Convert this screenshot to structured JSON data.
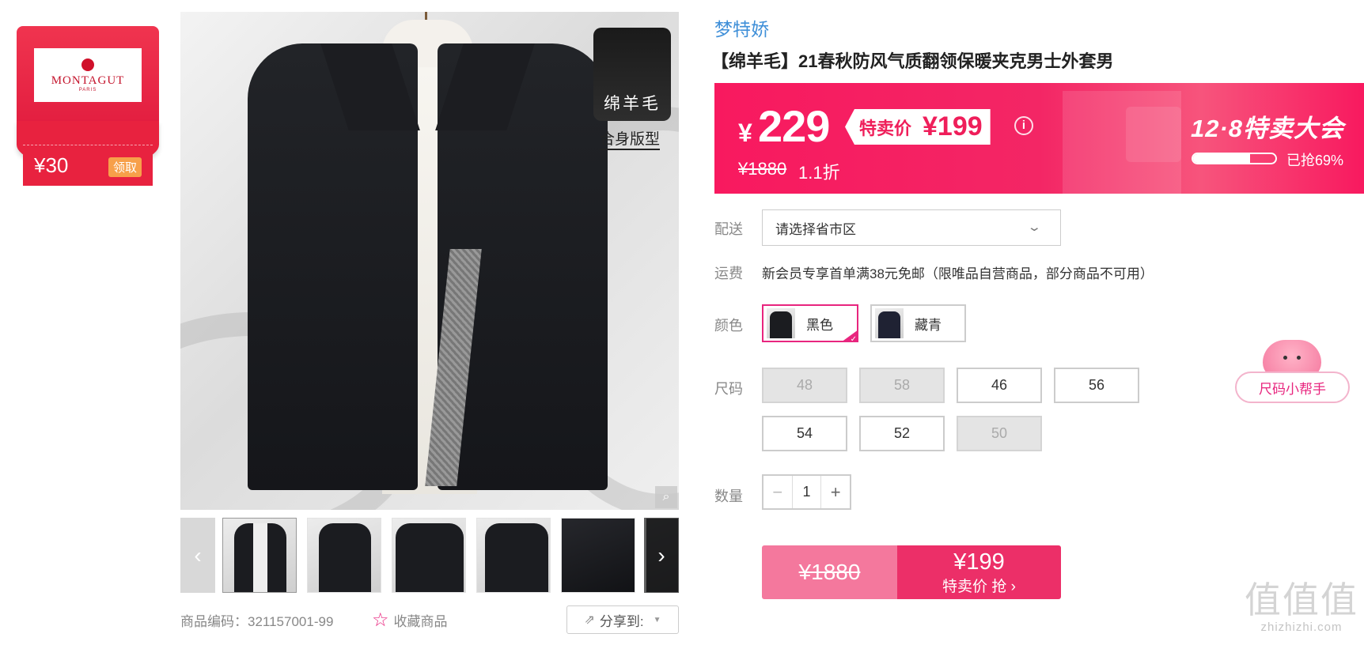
{
  "coupon": {
    "brand": "MONTAGUT",
    "brand_sub": "PARIS",
    "amount": "¥30",
    "claim_label": "领取"
  },
  "gallery": {
    "material_badge": "绵羊毛",
    "fit_label": "合身版型",
    "prev_icon": "‹",
    "next_icon": "›"
  },
  "meta": {
    "product_code": "商品编码：321157001-99",
    "favorite_label": "收藏商品",
    "share_label": "分享到:"
  },
  "product": {
    "brand_link": "梦特娇",
    "title": "【绵羊毛】21春秋防风气质翻领保暖夹克男士外套男"
  },
  "price": {
    "currency": "¥",
    "main": "229",
    "special_label": "特卖价",
    "special_value": "¥199",
    "info_icon": "i",
    "original": "¥1880",
    "discount": "1.1折",
    "event_title": "12·8特卖大会",
    "sold_progress": 0.69,
    "sold_text": "已抢69%"
  },
  "delivery": {
    "label": "配送",
    "select_value": "请选择省市区"
  },
  "shipping": {
    "label": "运费",
    "text": "新会员专享首单满38元免邮（限唯品自营商品，部分商品不可用）"
  },
  "colors": {
    "label": "颜色",
    "options": [
      {
        "name": "黑色",
        "selected": true
      },
      {
        "name": "藏青",
        "selected": false
      }
    ]
  },
  "sizes": {
    "label": "尺码",
    "options": [
      {
        "value": "48",
        "available": false
      },
      {
        "value": "58",
        "available": false
      },
      {
        "value": "46",
        "available": true
      },
      {
        "value": "56",
        "available": true
      },
      {
        "value": "54",
        "available": true
      },
      {
        "value": "52",
        "available": true
      },
      {
        "value": "50",
        "available": false
      }
    ],
    "helper_label": "尺码小帮手"
  },
  "quantity": {
    "label": "数量",
    "minus": "−",
    "value": "1",
    "plus": "+"
  },
  "buy": {
    "original_price": "¥1880",
    "special_price": "¥199",
    "action_label": "特卖价 抢 ›"
  },
  "watermark": {
    "big": "值值值",
    "small": "zhizhizhi.com"
  },
  "colors_theme": {
    "accent": "#e8257e",
    "banner": "#f8195f",
    "link": "#3f8fd8"
  }
}
